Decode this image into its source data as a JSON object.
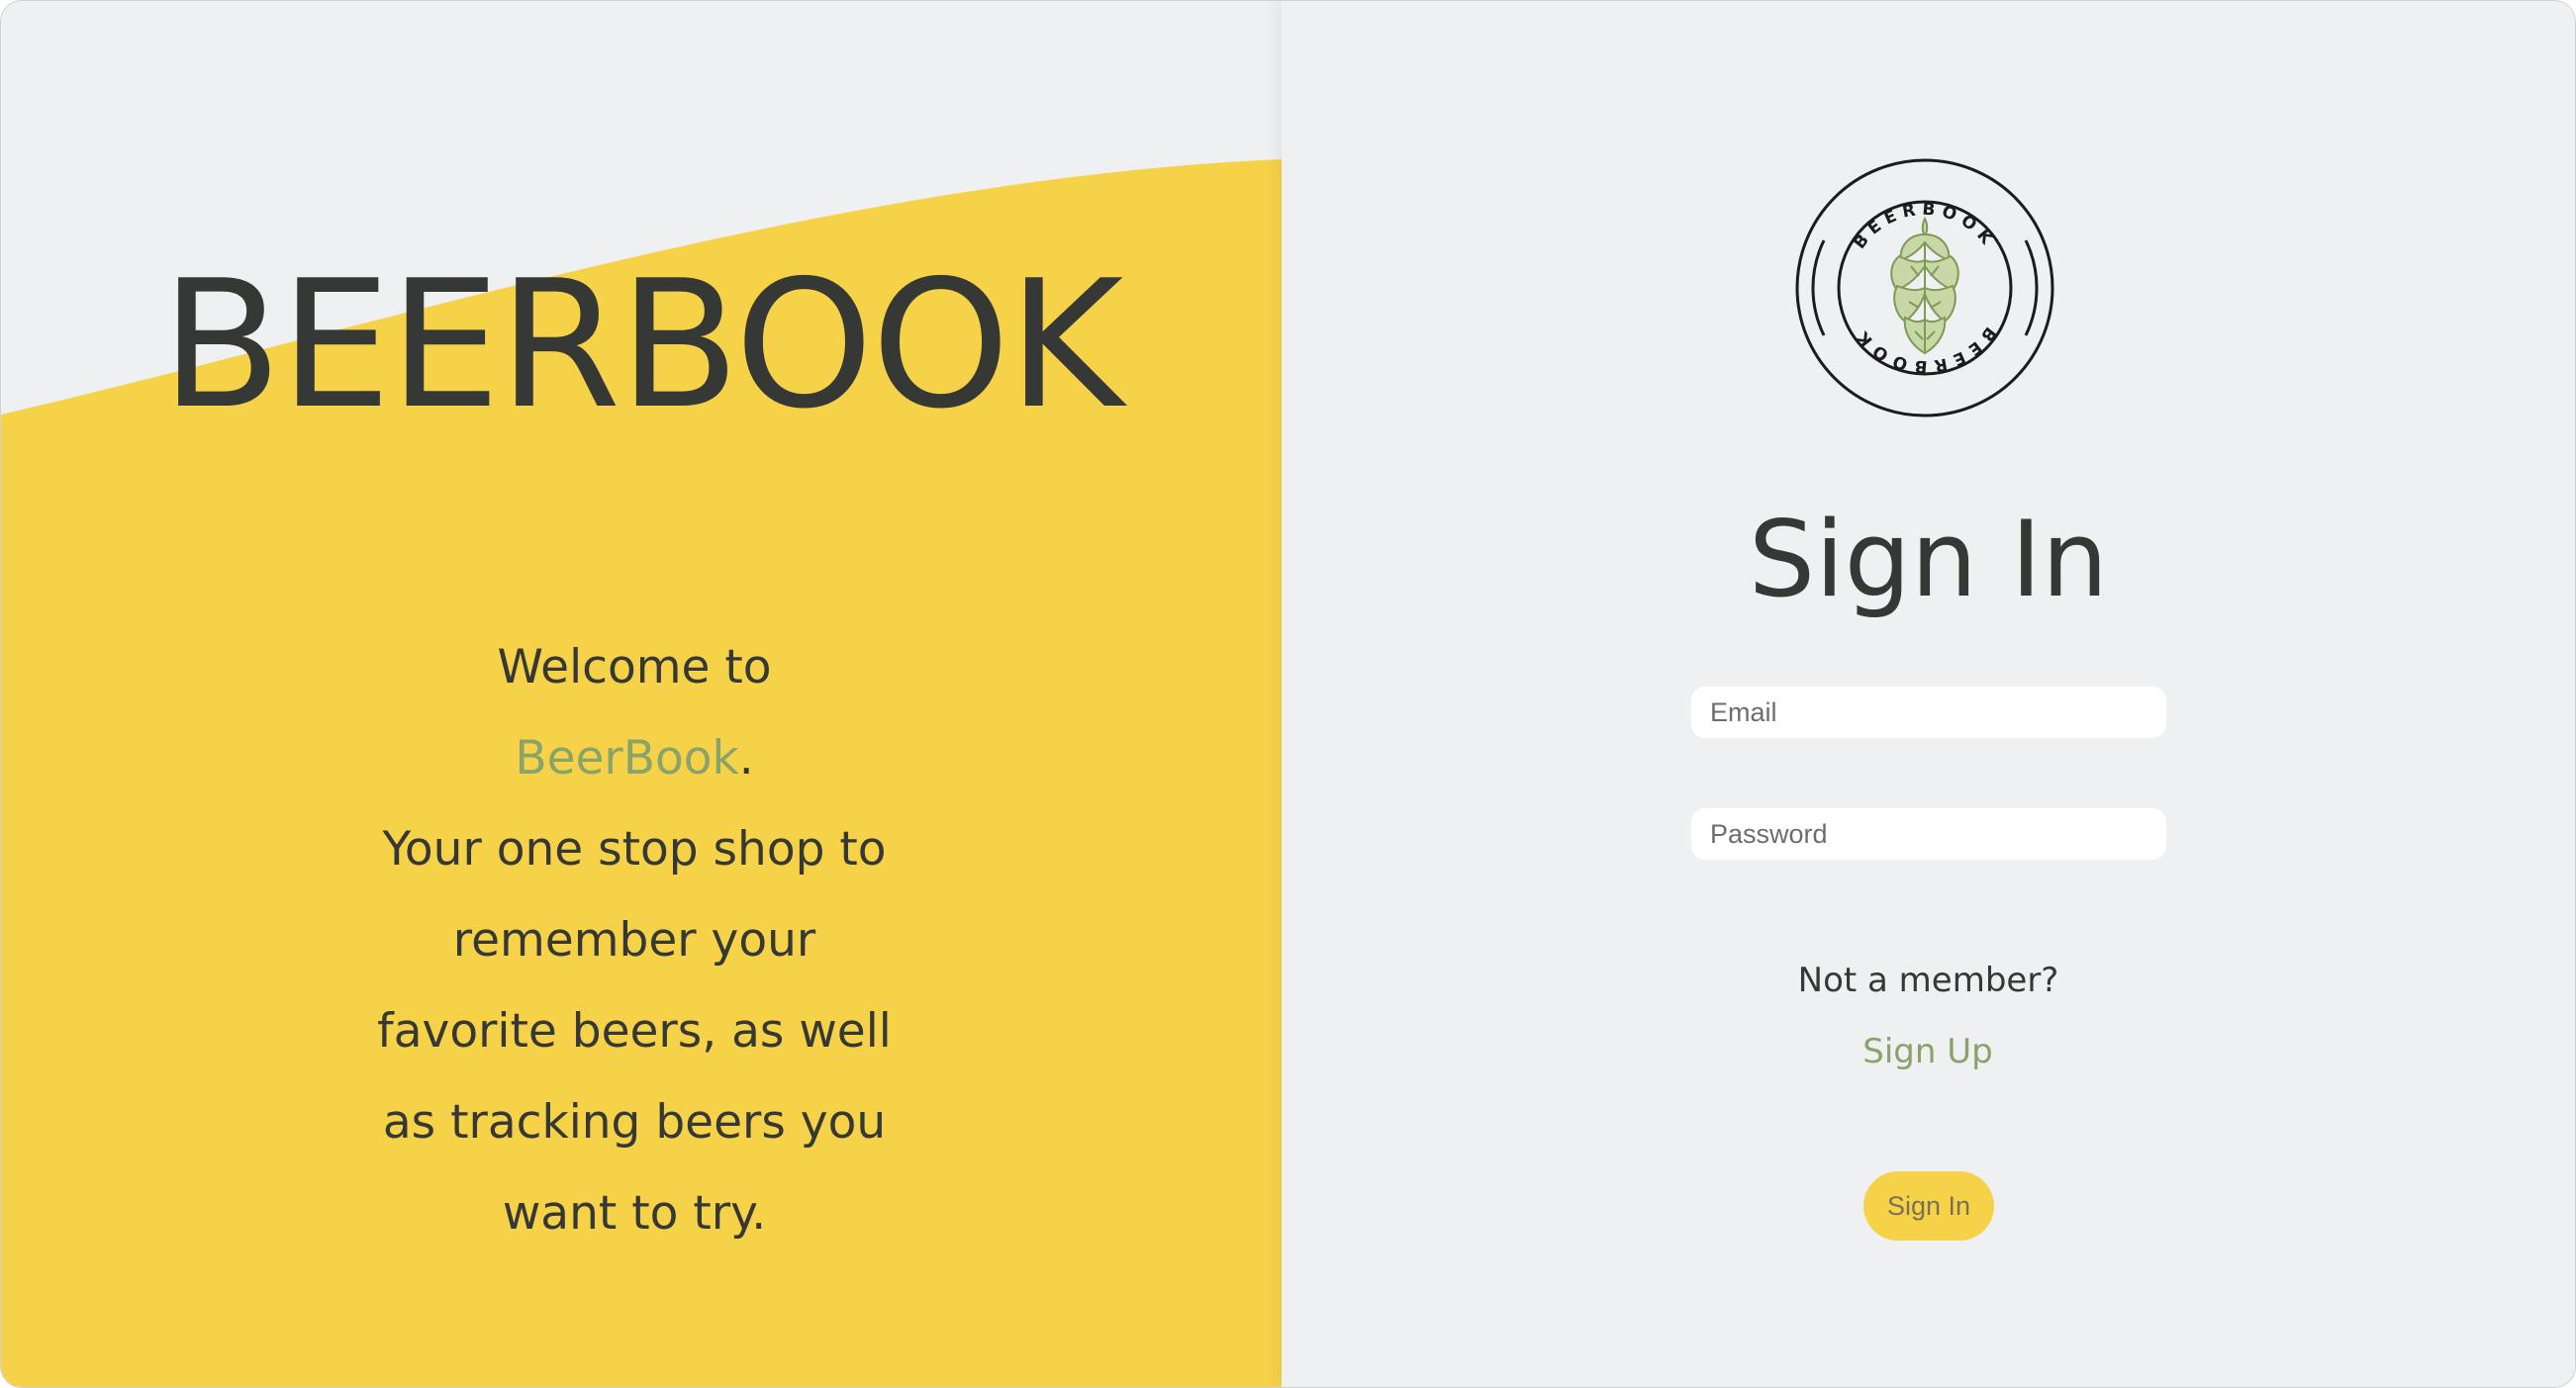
{
  "colors": {
    "background": "#eff0f2",
    "yellow": "#f6d249",
    "text_dark": "#363835",
    "accent_green": "#8aa36b"
  },
  "left": {
    "brand_title": "BEERBOOK",
    "welcome": {
      "line_1": "Welcome to",
      "brand_name": "BeerBook",
      "brand_suffix": ".",
      "lines": [
        "Your one stop shop to",
        "remember your",
        "favorite beers, as well",
        "as tracking beers you",
        "want to try."
      ]
    }
  },
  "right": {
    "logo": {
      "text_top": "BEERBOOK",
      "text_bottom": "BEERBOOK",
      "icon": "hop-cone-icon"
    },
    "heading": "Sign In",
    "email": {
      "placeholder": "Email",
      "value": ""
    },
    "password": {
      "placeholder": "Password",
      "value": ""
    },
    "not_member_text": "Not a member?",
    "signup_label": "Sign Up",
    "signin_button_label": "Sign In"
  }
}
